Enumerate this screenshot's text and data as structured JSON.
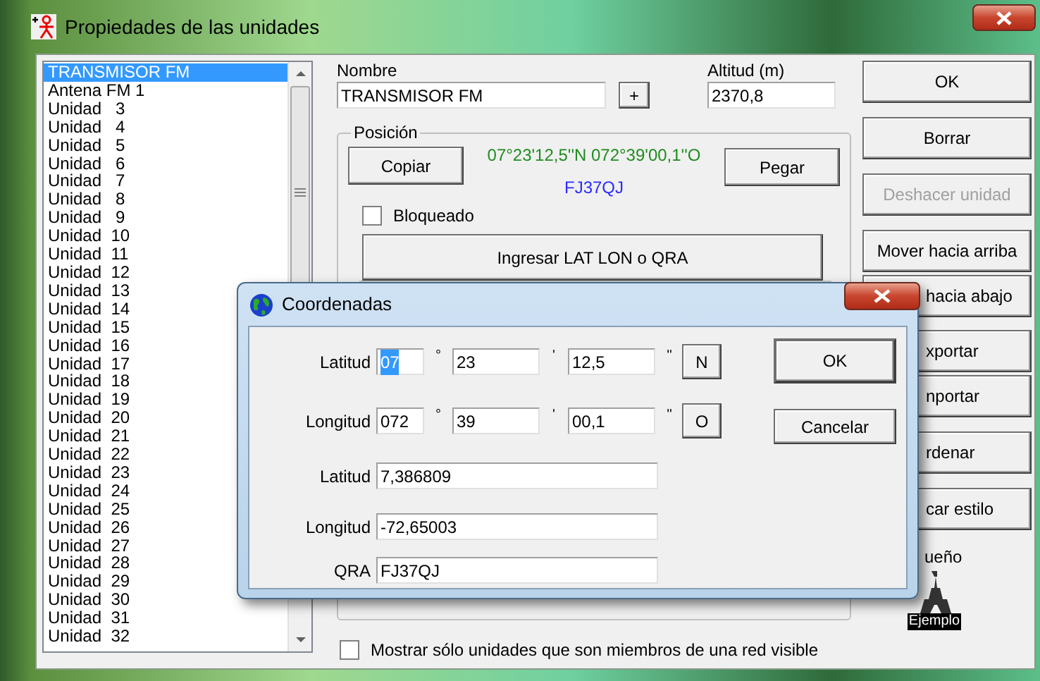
{
  "window": {
    "title": "Propiedades de las unidades"
  },
  "units": [
    {
      "label": "TRANSMISOR FM",
      "selected": true
    },
    {
      "label": "Antena FM 1",
      "selected": false
    },
    {
      "label": "Unidad   3",
      "selected": false
    },
    {
      "label": "Unidad   4",
      "selected": false
    },
    {
      "label": "Unidad   5",
      "selected": false
    },
    {
      "label": "Unidad   6",
      "selected": false
    },
    {
      "label": "Unidad   7",
      "selected": false
    },
    {
      "label": "Unidad   8",
      "selected": false
    },
    {
      "label": "Unidad   9",
      "selected": false
    },
    {
      "label": "Unidad  10",
      "selected": false
    },
    {
      "label": "Unidad  11",
      "selected": false
    },
    {
      "label": "Unidad  12",
      "selected": false
    },
    {
      "label": "Unidad  13",
      "selected": false
    },
    {
      "label": "Unidad  14",
      "selected": false
    },
    {
      "label": "Unidad  15",
      "selected": false
    },
    {
      "label": "Unidad  16",
      "selected": false
    },
    {
      "label": "Unidad  17",
      "selected": false
    },
    {
      "label": "Unidad  18",
      "selected": false
    },
    {
      "label": "Unidad  19",
      "selected": false
    },
    {
      "label": "Unidad  20",
      "selected": false
    },
    {
      "label": "Unidad  21",
      "selected": false
    },
    {
      "label": "Unidad  22",
      "selected": false
    },
    {
      "label": "Unidad  23",
      "selected": false
    },
    {
      "label": "Unidad  24",
      "selected": false
    },
    {
      "label": "Unidad  25",
      "selected": false
    },
    {
      "label": "Unidad  26",
      "selected": false
    },
    {
      "label": "Unidad  27",
      "selected": false
    },
    {
      "label": "Unidad  28",
      "selected": false
    },
    {
      "label": "Unidad  29",
      "selected": false
    },
    {
      "label": "Unidad  30",
      "selected": false
    },
    {
      "label": "Unidad  31",
      "selected": false
    },
    {
      "label": "Unidad  32",
      "selected": false
    }
  ],
  "name": {
    "label": "Nombre",
    "value": "TRANSMISOR FM",
    "add_button": "+"
  },
  "altitude": {
    "label": "Altitud (m)",
    "value": "2370,8"
  },
  "position": {
    "legend": "Posición",
    "copy_button": "Copiar",
    "coordinates": "07°23'12,5''N 072°39'00,1''O",
    "qra": "FJ37QJ",
    "paste_button": "Pegar",
    "locked": {
      "label": "Bloqueado",
      "checked": false
    },
    "enter_button": "Ingresar LAT LON o QRA"
  },
  "side_buttons": [
    {
      "label": "OK",
      "disabled": false,
      "covered": false
    },
    {
      "label": "Borrar",
      "disabled": false,
      "covered": false
    },
    {
      "label": "Deshacer unidad",
      "disabled": true,
      "covered": false
    },
    {
      "label": "Mover hacia arriba",
      "disabled": false,
      "covered": false
    },
    {
      "label": "hacia abajo",
      "disabled": false,
      "covered": true
    },
    {
      "label": "xportar",
      "disabled": false,
      "covered": true
    },
    {
      "label": "nportar",
      "disabled": false,
      "covered": true
    },
    {
      "label": "rdenar",
      "disabled": false,
      "covered": true
    },
    {
      "label": "car estilo",
      "disabled": false,
      "covered": true
    }
  ],
  "design": {
    "label": "ueño",
    "example": "Ejemplo"
  },
  "show_only": {
    "label": "Mostrar sólo unidades que son miembros de una red visible",
    "checked": false
  },
  "dialog": {
    "title": "Coordenadas",
    "dms": [
      {
        "label": "Latitud",
        "parts": [
          {
            "value": "07",
            "unit": "°",
            "selected": true
          },
          {
            "value": "23",
            "unit": "'",
            "selected": false
          },
          {
            "value": "12,5",
            "unit": "''",
            "selected": false
          }
        ],
        "hemisphere": "N"
      },
      {
        "label": "Longitud",
        "parts": [
          {
            "value": "072",
            "unit": "°",
            "selected": false
          },
          {
            "value": "39",
            "unit": "'",
            "selected": false
          },
          {
            "value": "00,1",
            "unit": "''",
            "selected": false
          }
        ],
        "hemisphere": "O"
      }
    ],
    "decimal": [
      {
        "label": "Latitud",
        "value": "7,386809"
      },
      {
        "label": "Longitud",
        "value": "-72,65003"
      },
      {
        "label": "QRA",
        "value": "FJ37QJ"
      }
    ],
    "buttons": [
      "OK",
      "Cancelar"
    ]
  }
}
